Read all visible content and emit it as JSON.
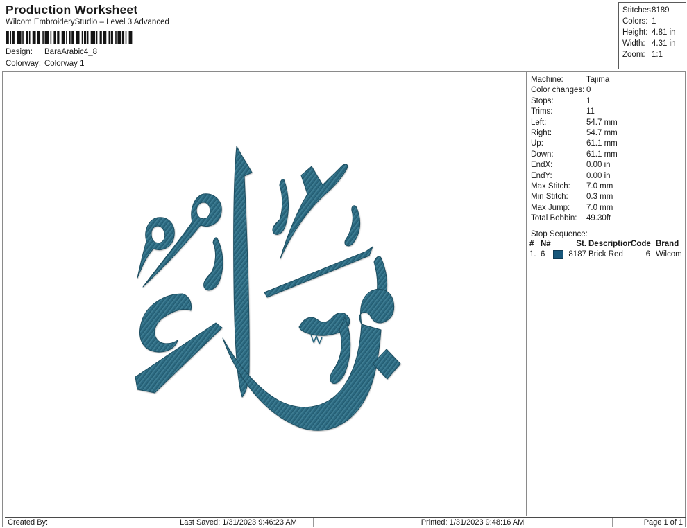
{
  "header": {
    "title": "Production Worksheet",
    "subtitle": "Wilcom EmbroideryStudio – Level 3 Advanced",
    "design_label": "Design:",
    "design_value": "BaraArabic4_8",
    "colorway_label": "Colorway:",
    "colorway_value": "Colorway 1"
  },
  "stats_box": {
    "rows": [
      {
        "label": "Stitches:",
        "value": "8189"
      },
      {
        "label": "Colors:",
        "value": "1"
      },
      {
        "label": "Height:",
        "value": "4.81 in"
      },
      {
        "label": "Width:",
        "value": "4.31 in"
      },
      {
        "label": "Zoom:",
        "value": "1:1"
      }
    ]
  },
  "machine_panel": {
    "rows": [
      {
        "label": "Machine:",
        "value": "Tajima"
      },
      {
        "label": "Color changes:",
        "value": "0"
      },
      {
        "label": "Stops:",
        "value": "1"
      },
      {
        "label": "Trims:",
        "value": "11"
      },
      {
        "label": "Left:",
        "value": "54.7 mm"
      },
      {
        "label": "Right:",
        "value": "54.7 mm"
      },
      {
        "label": "Up:",
        "value": "61.1 mm"
      },
      {
        "label": "Down:",
        "value": "61.1 mm"
      },
      {
        "label": "EndX:",
        "value": "0.00 in"
      },
      {
        "label": "EndY:",
        "value": "0.00 in"
      },
      {
        "label": "Max Stitch:",
        "value": "7.0 mm"
      },
      {
        "label": "Min Stitch:",
        "value": "0.3 mm"
      },
      {
        "label": "Max Jump:",
        "value": "7.0 mm"
      },
      {
        "label": "Total Bobbin:",
        "value": "49.30ft"
      }
    ]
  },
  "stop_sequence": {
    "title": "Stop Sequence:",
    "headers": {
      "num": "#",
      "n": "N#",
      "st": "St.",
      "description": "Description",
      "code": "Code",
      "brand": "Brand"
    },
    "rows": [
      {
        "num": "1.",
        "n": "6",
        "st": "8187",
        "description": "Brick Red",
        "code": "6",
        "brand": "Wilcom",
        "swatch_color": "#16567a"
      }
    ]
  },
  "design_preview": {
    "description": "Arabic calligraphy embroidery design (Baraa)",
    "thread_color": "#2c6880"
  },
  "footer": {
    "created_by": "Created By:",
    "last_saved": "Last Saved: 1/31/2023 9:46:23 AM",
    "printed": "Printed: 1/31/2023 9:48:16 AM",
    "page": "Page 1 of 1"
  }
}
